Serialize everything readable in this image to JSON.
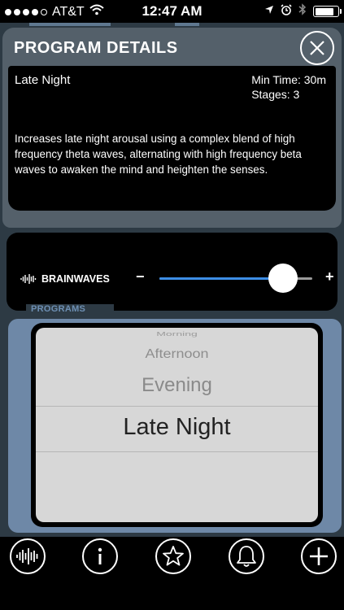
{
  "status_bar": {
    "carrier": "AT&T",
    "time": "12:47 AM",
    "battery_level": 0.82
  },
  "modal": {
    "title": "PROGRAM DETAILS",
    "program_name": "Late Night",
    "min_time": "Min Time: 30m",
    "stages": "Stages: 3",
    "description": "Increases late night arousal using a complex blend of high frequency theta waves, alternating with high frequency beta waves to awaken the mind and heighten the senses."
  },
  "brainwaves": {
    "label": "BRAINWAVES",
    "minus": "−",
    "plus": "+",
    "level": 0.81
  },
  "programs": {
    "label": "PROGRAMS",
    "items": [
      "Morning",
      "Afternoon",
      "Evening",
      "Late Night"
    ],
    "selected": "Late Night"
  },
  "bottom_nav": [
    "brainwave-icon",
    "info-icon",
    "star-icon",
    "bell-icon",
    "plus-icon"
  ],
  "colors": {
    "accent": "#3d8ee6",
    "panel": "#6e88a7",
    "frame": "#2d3a44"
  }
}
